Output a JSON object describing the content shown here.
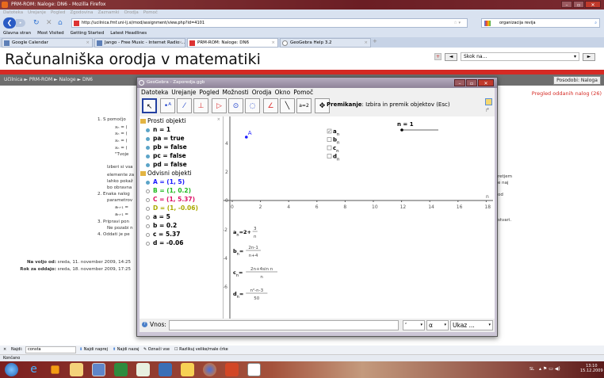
{
  "browser": {
    "window_title": "PRM-ROM: Naloge: DN6 - Mozilla Firefox",
    "menu": [
      "Datoteka",
      "Urejanje",
      "Pogled",
      "Zgodovina",
      "Zaznamki",
      "Orodja",
      "Pomoč"
    ],
    "url": "http://ucilnica.fmf.uni-lj.si/mod/assignment/view.php?id=4101",
    "search_value": "organizacija revija",
    "bookmarks": [
      "Glavna stran",
      "Most Visited",
      "Getting Started",
      "Latest Headlines"
    ],
    "tabs": [
      {
        "label": "Google Calendar"
      },
      {
        "label": "Jango - Free Music - Internet Radio ..."
      },
      {
        "label": "PRM-ROM: Naloge: DN6",
        "active": true
      },
      {
        "label": "GeoGebra Help 3.2"
      }
    ],
    "find": {
      "label": "Najdi:",
      "value": "consta",
      "next": "Najdi naprej",
      "prev": "Najdi nazaj",
      "highlight": "Označi vse",
      "match_case": "Razlikuj velike/male črke"
    },
    "status": "Končano"
  },
  "page": {
    "heading": "Računalniška orodja v matematiki",
    "jump_placeholder": "Skok na...",
    "breadcrumb": [
      "Učilnica",
      "PRM-ROM",
      "Naloge",
      "DN6"
    ],
    "update_button": "Posodobi: Naloga",
    "review_link": "Pregled oddanih nalog (26)",
    "content_lines": [
      "1.  S pomočjo",
      "xₙ = (",
      "xₙ = (",
      "xₙ = (",
      "xₙ = (",
      "\"Tvoje",
      "Izberi si vsa",
      "elemente za",
      "lahko pokaž",
      "bo obravna",
      "2.  Enaka nalog",
      "parametrov",
      "aₙ₊₁ =",
      "aₙ₊₁ =",
      "3.  Pripravi pon",
      "Ne pozabi n",
      "4.  Oddati je pe"
    ],
    "right_fragments": [
      "retjem",
      "e naj",
      "od",
      "stvari."
    ],
    "available_label": "Na voljo od:",
    "available_value": "sreda, 11. november 2009, 14:25",
    "due_label": "Rok za oddajo:",
    "due_value": "sreda, 18. november 2009, 17:25"
  },
  "geogebra": {
    "title": "GeoGebra - Zaporedja.ggb",
    "menu": [
      "Datoteka",
      "Urejanje",
      "Pogled",
      "Možnosti",
      "Orodja",
      "Okno",
      "Pomoč"
    ],
    "tool_help_bold": "Premikanje",
    "tool_help": ": Izbira in premik objektov (Esc)",
    "algebra": {
      "free_header": "Prosti objekti",
      "free": [
        "n = 1",
        "pa = true",
        "pb = false",
        "pc = false",
        "pd = false"
      ],
      "dependent_header": "Odvisni objekti",
      "dependent": [
        {
          "text": "A = (1, 5)",
          "color": "#1a1aff",
          "shown": true
        },
        {
          "text": "B = (1, 0.2)",
          "color": "#22bb22",
          "shown": false
        },
        {
          "text": "C = (1, 5.37)",
          "color": "#dd1166",
          "shown": false
        },
        {
          "text": "D = (1, -0.06)",
          "color": "#aaaa00",
          "shown": false
        },
        {
          "text": "a = 5",
          "color": "#000000",
          "shown": false
        },
        {
          "text": "b = 0.2",
          "color": "#000000",
          "shown": false
        },
        {
          "text": "c = 5.37",
          "color": "#000000",
          "shown": false
        },
        {
          "text": "d = -0.06",
          "color": "#000000",
          "shown": false
        }
      ]
    },
    "graphics": {
      "x_ticks": [
        "0",
        "2",
        "4",
        "6",
        "8",
        "10",
        "12",
        "14",
        "16",
        "18"
      ],
      "y_ticks_pos": [
        "4",
        "2",
        "0"
      ],
      "y_ticks_neg": [
        "-2",
        "-4",
        "-6"
      ],
      "x_axis_label": "n",
      "point_label": "A",
      "checkboxes": [
        {
          "label": "a",
          "sub": "n",
          "checked": true
        },
        {
          "label": "b",
          "sub": "n",
          "checked": false
        },
        {
          "label": "c",
          "sub": "n",
          "checked": false
        },
        {
          "label": "d",
          "sub": "n",
          "checked": false
        }
      ],
      "slider_label": "n = 1",
      "slider_value": 1,
      "slider_range": [
        1,
        20
      ],
      "formulas": [
        {
          "lhs": "a",
          "sub": "n",
          "pre": "=2+",
          "num": "3",
          "den": "n"
        },
        {
          "lhs": "b",
          "sub": "n",
          "pre": "=",
          "num": "2n-1",
          "den": "n+4"
        },
        {
          "lhs": "c",
          "sub": "n",
          "pre": "=",
          "num": "2n+4sin n",
          "den": "n"
        },
        {
          "lhs": "d",
          "sub": "n",
          "pre": "=",
          "num": "n²-n-3",
          "den": "50"
        }
      ]
    },
    "input": {
      "label": "Vnos:",
      "value": "",
      "exp_select": "²",
      "greek_select": "α",
      "cmd_select": "Ukaz ..."
    }
  },
  "taskbar": {
    "lang": "SL",
    "time": "13:10",
    "date": "15.12.2009"
  }
}
